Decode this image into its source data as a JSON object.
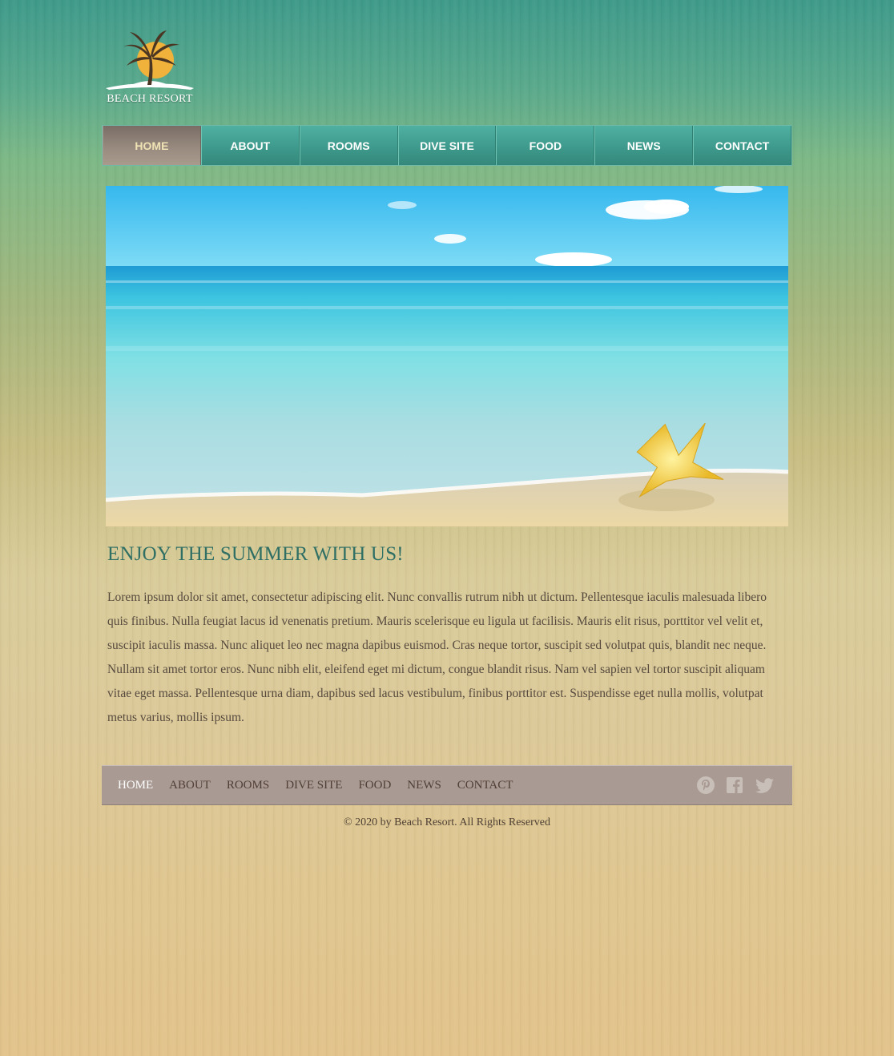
{
  "brand": {
    "name": "BEACH RESORT"
  },
  "nav": {
    "items": [
      {
        "label": "HOME",
        "active": true
      },
      {
        "label": "ABOUT"
      },
      {
        "label": "ROOMS"
      },
      {
        "label": "DIVE SITE"
      },
      {
        "label": "FOOD"
      },
      {
        "label": "NEWS"
      },
      {
        "label": "CONTACT"
      }
    ]
  },
  "main": {
    "heading": "ENJOY THE SUMMER WITH US!",
    "paragraph": "Lorem ipsum dolor sit amet, consectetur adipiscing elit. Nunc convallis rutrum nibh ut dictum. Pellentesque iaculis malesuada libero quis finibus. Nulla feugiat lacus id venenatis pretium. Mauris scelerisque eu ligula ut facilisis. Mauris elit risus, porttitor vel velit et, suscipit iaculis massa. Nunc aliquet leo nec magna dapibus euismod. Cras neque tortor, suscipit sed volutpat quis, blandit nec neque. Nullam sit amet tortor eros. Nunc nibh elit, eleifend eget mi dictum, congue blandit risus. Nam vel sapien vel tortor suscipit aliquam vitae eget massa. Pellentesque urna diam, dapibus sed lacus vestibulum, finibus porttitor est. Suspendisse eget nulla mollis, volutpat metus varius, mollis ipsum."
  },
  "footer": {
    "links": [
      {
        "label": "HOME",
        "active": true
      },
      {
        "label": "ABOUT"
      },
      {
        "label": "ROOMS"
      },
      {
        "label": "DIVE SITE"
      },
      {
        "label": "FOOD"
      },
      {
        "label": "NEWS"
      },
      {
        "label": "CONTACT"
      }
    ],
    "social_icons": [
      "pinterest-icon",
      "facebook-icon",
      "twitter-icon"
    ],
    "copyright": "© 2020 by Beach Resort. All Rights Reserved"
  },
  "colors": {
    "nav_teal": "#3e9a8c",
    "nav_active": "#9a8c80",
    "nav_active_text": "#efe3b5",
    "heading": "#2f6f64",
    "footer_bar": "#a99a93"
  }
}
